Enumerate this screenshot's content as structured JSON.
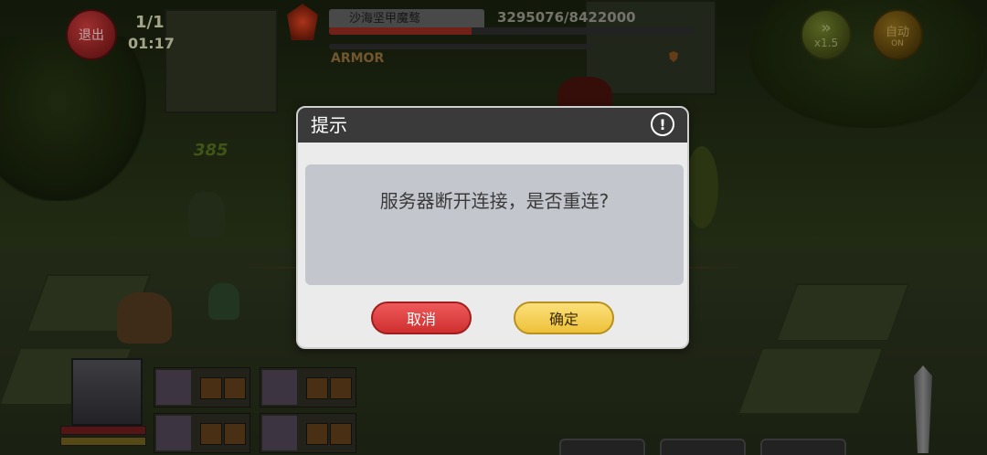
{
  "hud": {
    "exit_label": "退出",
    "wave": "1/1",
    "timer": "01:17",
    "speed_label": "x1.5",
    "auto_label": "自动",
    "auto_sub": "ON"
  },
  "boss": {
    "name": "沙海坚甲魔骜",
    "hp_text": "3295076/8422000",
    "hp_fraction": 0.39,
    "armor_label": "ARMOR"
  },
  "combat_text": [
    "385"
  ],
  "dialog": {
    "title": "提示",
    "info_icon": "!",
    "message": "服务器断开连接，是否重连?",
    "cancel_label": "取消",
    "confirm_label": "确定"
  },
  "colors": {
    "cancel_button": "#e14646",
    "confirm_button": "#f4cf52",
    "dialog_header": "#3a3a3a",
    "dialog_body": "#c3c6cc"
  }
}
